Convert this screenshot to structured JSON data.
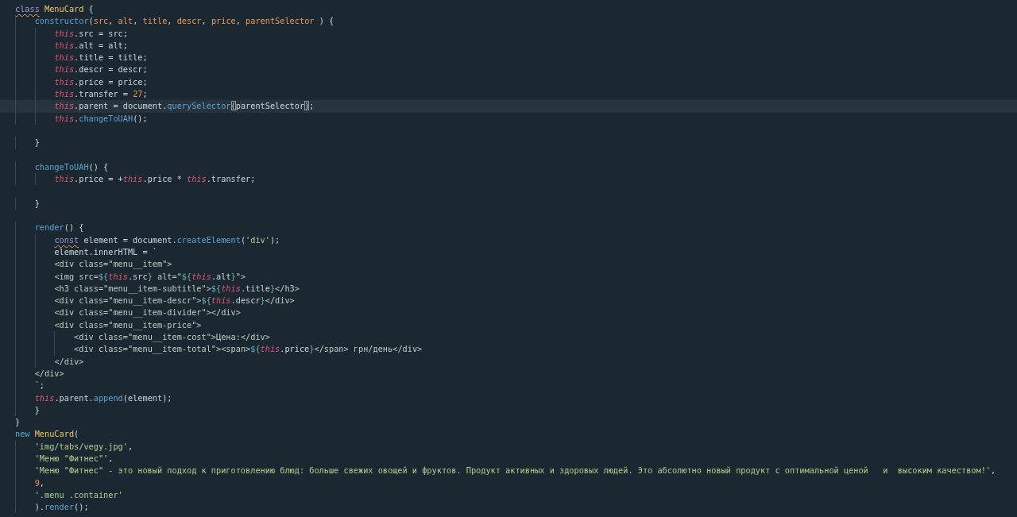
{
  "editor": {
    "lines": [
      {
        "current": false,
        "tokens": [
          {
            "kind": "storage-flagged",
            "text": "class"
          },
          {
            "kind": "class-name",
            "text": " MenuCard"
          },
          {
            "kind": "plain",
            "text": " {"
          }
        ]
      },
      {
        "current": false,
        "tokens": [
          {
            "kind": "function",
            "text": "    constructor"
          },
          {
            "kind": "plain",
            "text": "("
          },
          {
            "kind": "param",
            "text": "src"
          },
          {
            "kind": "plain",
            "text": ", "
          },
          {
            "kind": "param",
            "text": "alt"
          },
          {
            "kind": "plain",
            "text": ", "
          },
          {
            "kind": "param",
            "text": "title"
          },
          {
            "kind": "plain",
            "text": ", "
          },
          {
            "kind": "param",
            "text": "descr"
          },
          {
            "kind": "plain",
            "text": ", "
          },
          {
            "kind": "param",
            "text": "price"
          },
          {
            "kind": "plain",
            "text": ", "
          },
          {
            "kind": "param",
            "text": "parentSelector"
          },
          {
            "kind": "plain",
            "text": " ) {"
          }
        ]
      },
      {
        "current": false,
        "tokens": [
          {
            "kind": "this",
            "text": "        this"
          },
          {
            "kind": "plain",
            "text": ".src = src;"
          }
        ]
      },
      {
        "current": false,
        "tokens": [
          {
            "kind": "this",
            "text": "        this"
          },
          {
            "kind": "plain",
            "text": ".alt = alt;"
          }
        ]
      },
      {
        "current": false,
        "tokens": [
          {
            "kind": "this",
            "text": "        this"
          },
          {
            "kind": "plain",
            "text": ".title = title;"
          }
        ]
      },
      {
        "current": false,
        "tokens": [
          {
            "kind": "this",
            "text": "        this"
          },
          {
            "kind": "plain",
            "text": ".descr = descr;"
          }
        ]
      },
      {
        "current": false,
        "tokens": [
          {
            "kind": "this",
            "text": "        this"
          },
          {
            "kind": "plain",
            "text": ".price = price;"
          }
        ]
      },
      {
        "current": false,
        "tokens": [
          {
            "kind": "this",
            "text": "        this"
          },
          {
            "kind": "plain",
            "text": ".transfer = "
          },
          {
            "kind": "number",
            "text": "27"
          },
          {
            "kind": "plain",
            "text": ";"
          }
        ]
      },
      {
        "current": true,
        "tokens": [
          {
            "kind": "this",
            "text": "        this"
          },
          {
            "kind": "plain",
            "text": ".parent = document."
          },
          {
            "kind": "function",
            "text": "querySelector"
          },
          {
            "kind": "bracket-matched",
            "text": "("
          },
          {
            "kind": "plain",
            "text": "parentSelector"
          },
          {
            "kind": "bracket-matched",
            "text": ")"
          },
          {
            "kind": "plain",
            "text": ";"
          }
        ]
      },
      {
        "current": false,
        "tokens": [
          {
            "kind": "this",
            "text": "        this"
          },
          {
            "kind": "plain",
            "text": "."
          },
          {
            "kind": "function",
            "text": "changeToUAH"
          },
          {
            "kind": "plain",
            "text": "();"
          }
        ]
      },
      {
        "current": false
      },
      {
        "current": false,
        "tokens": [
          {
            "kind": "plain",
            "text": "    }"
          }
        ]
      },
      {
        "current": false
      },
      {
        "current": false,
        "tokens": [
          {
            "kind": "function",
            "text": "    changeToUAH"
          },
          {
            "kind": "plain",
            "text": "() {"
          }
        ]
      },
      {
        "current": false,
        "tokens": [
          {
            "kind": "this",
            "text": "        this"
          },
          {
            "kind": "plain",
            "text": ".price = +"
          },
          {
            "kind": "this",
            "text": "this"
          },
          {
            "kind": "plain",
            "text": ".price * "
          },
          {
            "kind": "this",
            "text": "this"
          },
          {
            "kind": "plain",
            "text": ".transfer;"
          }
        ]
      },
      {
        "current": false
      },
      {
        "current": false,
        "tokens": [
          {
            "kind": "plain",
            "text": "    }"
          }
        ]
      },
      {
        "current": false
      },
      {
        "current": false,
        "tokens": [
          {
            "kind": "function",
            "text": "    render"
          },
          {
            "kind": "plain",
            "text": "() {"
          }
        ]
      },
      {
        "current": false,
        "tokens": [
          {
            "kind": "storage-flagged",
            "text": "        const"
          },
          {
            "kind": "plain",
            "text": " element = document."
          },
          {
            "kind": "function",
            "text": "createElement"
          },
          {
            "kind": "plain",
            "text": "("
          },
          {
            "kind": "string",
            "text": "'div'"
          },
          {
            "kind": "plain",
            "text": ");"
          }
        ]
      },
      {
        "current": false,
        "tokens": [
          {
            "kind": "plain",
            "text": "        element.innerHTML = "
          },
          {
            "kind": "template",
            "text": "`"
          }
        ]
      },
      {
        "current": false,
        "tokens": [
          {
            "kind": "template",
            "text": "        <div class=\"menu__item\">"
          }
        ]
      },
      {
        "current": false,
        "tokens": [
          {
            "kind": "template",
            "text": "        <img src="
          },
          {
            "kind": "interpolation",
            "text": "${"
          },
          {
            "kind": "this",
            "text": "this"
          },
          {
            "kind": "plain",
            "text": ".src"
          },
          {
            "kind": "interpolation",
            "text": "}"
          },
          {
            "kind": "template",
            "text": " alt=\""
          },
          {
            "kind": "interpolation",
            "text": "${"
          },
          {
            "kind": "this",
            "text": "this"
          },
          {
            "kind": "plain",
            "text": ".alt"
          },
          {
            "kind": "interpolation",
            "text": "}"
          },
          {
            "kind": "template",
            "text": "\">"
          }
        ]
      },
      {
        "current": false,
        "tokens": [
          {
            "kind": "template",
            "text": "        <h3 class=\"menu__item-subtitle\">"
          },
          {
            "kind": "interpolation",
            "text": "${"
          },
          {
            "kind": "this",
            "text": "this"
          },
          {
            "kind": "plain",
            "text": ".title"
          },
          {
            "kind": "interpolation",
            "text": "}"
          },
          {
            "kind": "template",
            "text": "</h3>"
          }
        ]
      },
      {
        "current": false,
        "tokens": [
          {
            "kind": "template",
            "text": "        <div class=\"menu__item-descr\">"
          },
          {
            "kind": "interpolation",
            "text": "${"
          },
          {
            "kind": "this",
            "text": "this"
          },
          {
            "kind": "plain",
            "text": ".descr"
          },
          {
            "kind": "interpolation",
            "text": "}"
          },
          {
            "kind": "template",
            "text": "</div>"
          }
        ]
      },
      {
        "current": false,
        "tokens": [
          {
            "kind": "template",
            "text": "        <div class=\"menu__item-divider\"></div>"
          }
        ]
      },
      {
        "current": false,
        "tokens": [
          {
            "kind": "template",
            "text": "        <div class=\"menu__item-price\">"
          }
        ]
      },
      {
        "current": false,
        "tokens": [
          {
            "kind": "template",
            "text": "            <div class=\"menu__item-cost\">Цена:</div>"
          }
        ]
      },
      {
        "current": false,
        "tokens": [
          {
            "kind": "template",
            "text": "            <div class=\"menu__item-total\"><span>"
          },
          {
            "kind": "interpolation",
            "text": "${"
          },
          {
            "kind": "this",
            "text": "this"
          },
          {
            "kind": "plain",
            "text": ".price"
          },
          {
            "kind": "interpolation",
            "text": "}"
          },
          {
            "kind": "template",
            "text": "</span> грн/день</div>"
          }
        ]
      },
      {
        "current": false,
        "tokens": [
          {
            "kind": "template",
            "text": "        </div>"
          }
        ]
      },
      {
        "current": false,
        "tokens": [
          {
            "kind": "template",
            "text": "    </div>"
          }
        ]
      },
      {
        "current": false,
        "tokens": [
          {
            "kind": "template",
            "text": "    `"
          },
          {
            "kind": "plain",
            "text": ";"
          }
        ]
      },
      {
        "current": false,
        "tokens": [
          {
            "kind": "this",
            "text": "    this"
          },
          {
            "kind": "plain",
            "text": ".parent."
          },
          {
            "kind": "function",
            "text": "append"
          },
          {
            "kind": "plain",
            "text": "(element);"
          }
        ]
      },
      {
        "current": false,
        "tokens": [
          {
            "kind": "plain",
            "text": "    }"
          }
        ]
      },
      {
        "current": false,
        "tokens": [
          {
            "kind": "plain",
            "text": "}"
          }
        ]
      },
      {
        "current": false,
        "tokens": [
          {
            "kind": "keyword",
            "text": "new"
          },
          {
            "kind": "class-name",
            "text": " MenuCard"
          },
          {
            "kind": "plain",
            "text": "("
          }
        ]
      },
      {
        "current": false,
        "tokens": [
          {
            "kind": "string",
            "text": "    'img/tabs/vegy.jpg'"
          },
          {
            "kind": "plain",
            "text": ","
          }
        ]
      },
      {
        "current": false,
        "tokens": [
          {
            "kind": "string",
            "text": "    'Меню \"Фитнес\"'"
          },
          {
            "kind": "plain",
            "text": ","
          }
        ]
      },
      {
        "current": false,
        "tokens": [
          {
            "kind": "string",
            "text": "    'Меню \"Фитнес\" - это новый подход к приготовлению блюд: больше свежих овощей и фруктов. Продукт активных и здоровых людей. Это абсолютно новый продукт с оптимальной ценой   и  высоким качеством!'"
          },
          {
            "kind": "plain",
            "text": ","
          }
        ]
      },
      {
        "current": false,
        "tokens": [
          {
            "kind": "number",
            "text": "    9"
          },
          {
            "kind": "plain",
            "text": ","
          }
        ]
      },
      {
        "current": false,
        "tokens": [
          {
            "kind": "string",
            "text": "    '.menu .container'"
          }
        ]
      },
      {
        "current": false,
        "tokens": [
          {
            "kind": "plain",
            "text": "    )."
          },
          {
            "kind": "function",
            "text": "render"
          },
          {
            "kind": "plain",
            "text": "();"
          }
        ]
      }
    ]
  }
}
